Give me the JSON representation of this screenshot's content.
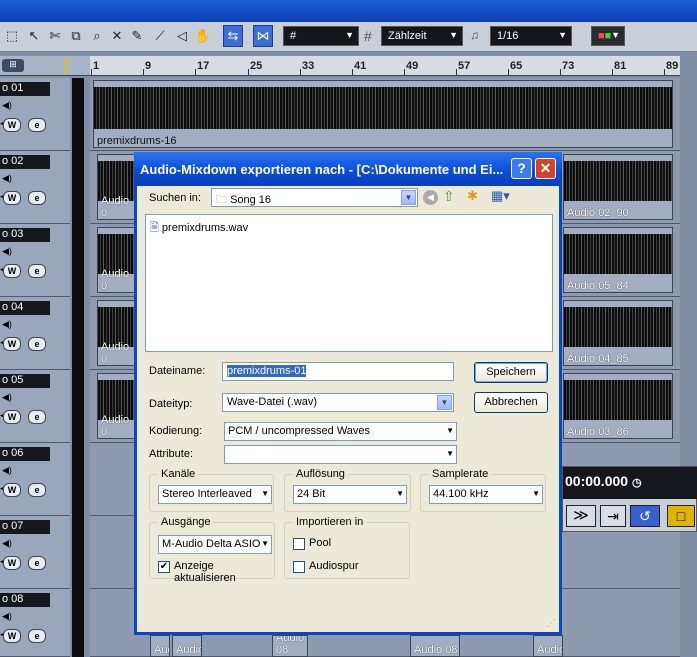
{
  "toolbar": {
    "grid_type": "Zählzeit",
    "quantize": "1/16"
  },
  "ruler": {
    "marks": [
      "1",
      "9",
      "17",
      "25",
      "33",
      "41",
      "49",
      "57",
      "65",
      "73",
      "81",
      "89"
    ]
  },
  "tracks": [
    {
      "name": "o 01"
    },
    {
      "name": "o 02"
    },
    {
      "name": "o 03"
    },
    {
      "name": "o 04"
    },
    {
      "name": "o 05"
    },
    {
      "name": "o 06"
    },
    {
      "name": "o 07"
    },
    {
      "name": "o 08"
    }
  ],
  "clips": {
    "premix": "premixdrums-16",
    "a2l": "Audio 0",
    "a2r": "Audio 02_90",
    "a3l": "Audio 0",
    "a3r": "Audio 05_84",
    "a4l": "Audio 0",
    "a4r": "Audio 04_85",
    "a5l": "Audio 0",
    "a5r": "Audio 03_86",
    "b1": "Audio",
    "b2": "Audio",
    "b3": "Audio 08",
    "b4": "Audio"
  },
  "transport": {
    "time": "00:00.000"
  },
  "track_buttons": {
    "write": "W",
    "edit": "e"
  },
  "dialog": {
    "title": "Audio-Mixdown exportieren nach - [C:\\Dokumente und Ei...",
    "help": "?",
    "close": "✕",
    "search_label": "Suchen in:",
    "search_value": "Song 16",
    "files": [
      "premixdrums.wav"
    ],
    "filename_label": "Dateiname:",
    "filename_value": "premixdrums-01",
    "filetype_label": "Dateityp:",
    "filetype_value": "Wave-Datei (.wav)",
    "save": "Speichern",
    "cancel": "Abbrechen",
    "encoding_label": "Kodierung:",
    "encoding_value": "PCM / uncompressed Waves",
    "attribute_label": "Attribute:",
    "attribute_value": "",
    "channels_label": "Kanäle",
    "channels_value": "Stereo Interleaved",
    "resolution_label": "Auflösung",
    "resolution_value": "24 Bit",
    "samplerate_label": "Samplerate",
    "samplerate_value": "44.100 kHz",
    "outputs_label": "Ausgänge",
    "outputs_value": "M-Audio Delta ASIO",
    "refresh_label": "Anzeige aktualisieren",
    "refresh_checked": true,
    "import_label": "Importieren in",
    "pool_label": "Pool",
    "pool_checked": false,
    "audiotrack_label": "Audiospur",
    "audiotrack_checked": false
  }
}
